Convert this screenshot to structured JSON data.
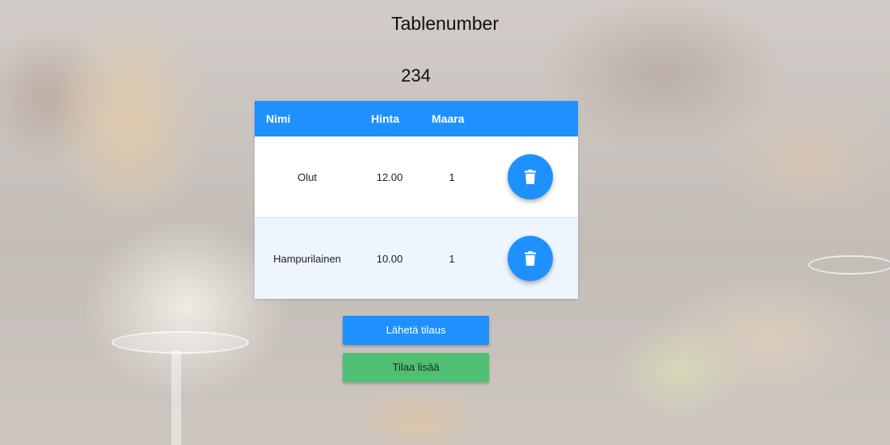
{
  "header": {
    "title": "Tablenumber",
    "table_number": "234"
  },
  "table": {
    "columns": [
      "Nimi",
      "Hinta",
      "Maara"
    ],
    "rows": [
      {
        "name": "Olut",
        "price": "12.00",
        "quantity": "1"
      },
      {
        "name": "Hampurilainen",
        "price": "10.00",
        "quantity": "1"
      }
    ]
  },
  "actions": {
    "send_label": "Lähetä tilaus",
    "order_more_label": "Tilaa lisää"
  },
  "icons": {
    "delete": "trash-icon"
  },
  "colors": {
    "primary": "#1e90ff",
    "success": "#4fbf73",
    "row_alt": "#eef5ff"
  }
}
